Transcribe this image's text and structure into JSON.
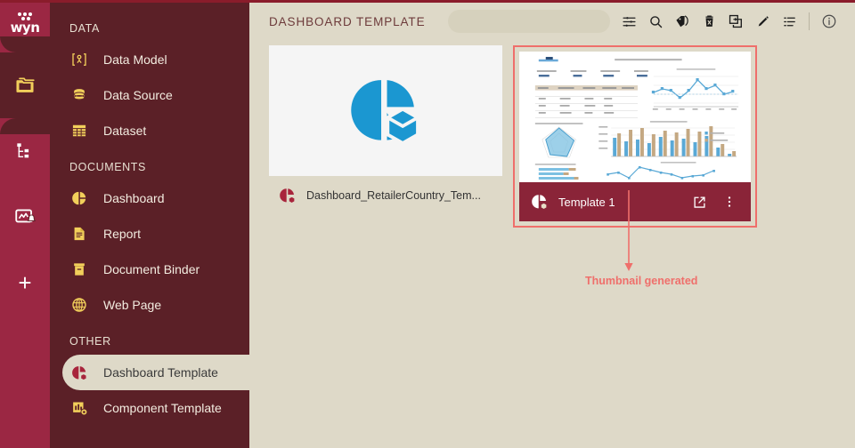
{
  "brand": {
    "logo_text": "wyn"
  },
  "colors": {
    "rail": "#9b2743",
    "sidebar": "#5b2027",
    "page_bg": "#ded9c8",
    "accent_yellow": "#f2cf5b",
    "selection_red": "#ef6f6b",
    "card_footer_selected": "#8a2438",
    "title_text": "#6d3b3b"
  },
  "rail": {
    "items": [
      {
        "name": "folders-icon",
        "label": "Documents",
        "active": true
      },
      {
        "name": "hierarchy-icon",
        "label": "Hierarchy",
        "active": false
      },
      {
        "name": "monitor-alert-icon",
        "label": "Monitoring",
        "active": false
      },
      {
        "name": "plus-icon",
        "label": "Create",
        "active": false
      }
    ]
  },
  "sidebar": {
    "groups": [
      {
        "title": "DATA",
        "items": [
          {
            "label": "Data Model",
            "icon": "data-model-icon",
            "selected": false
          },
          {
            "label": "Data Source",
            "icon": "database-icon",
            "selected": false
          },
          {
            "label": "Dataset",
            "icon": "table-grid-icon",
            "selected": false
          }
        ]
      },
      {
        "title": "DOCUMENTS",
        "items": [
          {
            "label": "Dashboard",
            "icon": "dashboard-pie-icon",
            "selected": false
          },
          {
            "label": "Report",
            "icon": "report-doc-icon",
            "selected": false
          },
          {
            "label": "Document Binder",
            "icon": "binder-icon",
            "selected": false
          },
          {
            "label": "Web Page",
            "icon": "globe-icon",
            "selected": false
          }
        ]
      },
      {
        "title": "OTHER",
        "items": [
          {
            "label": "Dashboard Template",
            "icon": "dashboard-template-icon",
            "selected": true
          },
          {
            "label": "Component Template",
            "icon": "component-template-icon",
            "selected": false
          }
        ]
      }
    ]
  },
  "header": {
    "title": "DASHBOARD TEMPLATE",
    "search": {
      "value": "",
      "placeholder": ""
    },
    "tools": [
      {
        "name": "filter-sliders-icon",
        "label": "Filter"
      },
      {
        "name": "search-icon",
        "label": "Search"
      },
      {
        "name": "tag-icon",
        "label": "Tags"
      },
      {
        "name": "trash-icon",
        "label": "Delete"
      },
      {
        "name": "copy-icon",
        "label": "Copy"
      },
      {
        "name": "pencil-icon",
        "label": "Edit"
      },
      {
        "name": "list-icon",
        "label": "List View"
      }
    ],
    "info_tool": {
      "name": "info-icon",
      "label": "Info"
    }
  },
  "cards": [
    {
      "name": "Dashboard_RetailerCountry_Tem...",
      "icon": "dashboard-template-icon",
      "selected": false,
      "thumbnail": "placeholder-pie-cube"
    },
    {
      "name": "Template 1",
      "icon": "dashboard-template-icon",
      "selected": true,
      "thumbnail": "generated-dashboard",
      "actions": [
        {
          "name": "open-external-icon",
          "label": "Open"
        },
        {
          "name": "more-options-icon",
          "label": "More"
        }
      ]
    }
  ],
  "annotation": {
    "text": "Thumbnail generated",
    "color": "#ef6f6b"
  }
}
